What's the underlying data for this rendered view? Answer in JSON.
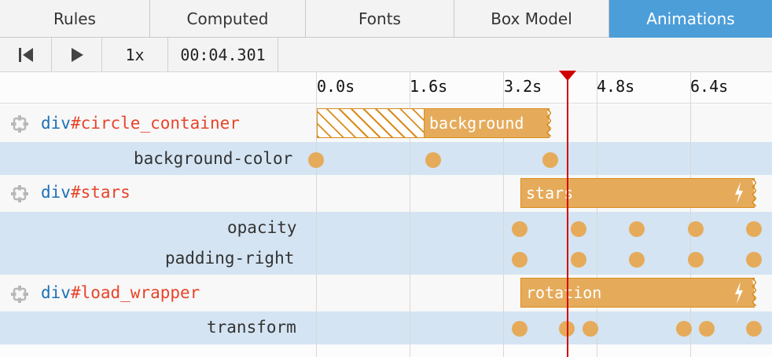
{
  "tabs": [
    "Rules",
    "Computed",
    "Fonts",
    "Box Model",
    "Animations"
  ],
  "active_tab": "Animations",
  "toolbar": {
    "rewind_icon": "skip-to-start-icon",
    "play_icon": "play-icon",
    "rate": "1x",
    "time": "00:04.301"
  },
  "timeline": {
    "ticks": [
      "0.0s",
      "1.6s",
      "3.2s",
      "4.8s",
      "6.4s"
    ],
    "current_time_s": 4.301
  },
  "rows": [
    {
      "tag": "div",
      "id": "#circle_container",
      "animation": "background",
      "properties": [
        "background-color"
      ]
    },
    {
      "tag": "div",
      "id": "#stars",
      "animation": "stars",
      "properties": [
        "opacity",
        "padding-right"
      ]
    },
    {
      "tag": "div",
      "id": "#load_wrapper",
      "animation": "rotation",
      "properties": [
        "transform"
      ]
    }
  ],
  "colors": {
    "active_tab": "#4c9ed9",
    "bar_fill": "#e5ab5b",
    "bar_border": "#d98c1c",
    "playhead": "#d10000",
    "selector_tag": "#1c70b8",
    "selector_id": "#e7442a",
    "property_row": "#d4e4f2"
  }
}
